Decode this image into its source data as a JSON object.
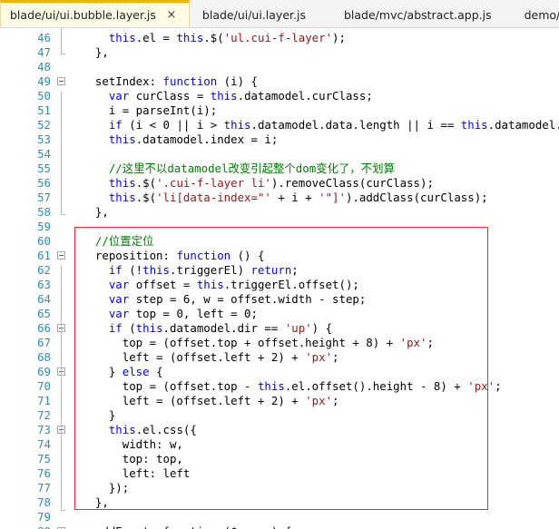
{
  "tabs": [
    {
      "label": "blade/ui/ui.bubble.layer.js",
      "active": true,
      "close": "×"
    },
    {
      "label": "blade/ui/ui.layer.js",
      "active": false
    },
    {
      "label": "blade/mvc/abstract.app.js",
      "active": false
    },
    {
      "label": "demo/main.js",
      "active": false
    }
  ],
  "colors": {
    "accent": "#f0b400",
    "keyword": "#0000ff",
    "string": "#a31515",
    "comment": "#008000",
    "line_number": "#2b91af",
    "highlight_border": "#d9312b"
  },
  "lines": [
    {
      "n": "46",
      "tokens": [
        [
          "",
          "    "
        ],
        [
          "kw",
          "this"
        ],
        [
          "",
          ".el = "
        ],
        [
          "kw",
          "this"
        ],
        [
          "",
          ".$("
        ],
        [
          "str",
          "'ul.cui-f-layer'"
        ],
        [
          "",
          ");"
        ]
      ]
    },
    {
      "n": "47",
      "tokens": [
        [
          "",
          "  },"
        ]
      ]
    },
    {
      "n": "48",
      "tokens": [
        [
          "",
          ""
        ]
      ]
    },
    {
      "n": "49",
      "fold": true,
      "tokens": [
        [
          "",
          "  setIndex: "
        ],
        [
          "kw",
          "function"
        ],
        [
          "",
          " (i) {"
        ]
      ]
    },
    {
      "n": "50",
      "tokens": [
        [
          "",
          "    "
        ],
        [
          "kw",
          "var"
        ],
        [
          "",
          " curClass = "
        ],
        [
          "kw",
          "this"
        ],
        [
          "",
          ".datamodel.curClass;"
        ]
      ]
    },
    {
      "n": "51",
      "tokens": [
        [
          "",
          "    i = parseInt(i);"
        ]
      ]
    },
    {
      "n": "52",
      "tokens": [
        [
          "",
          "    "
        ],
        [
          "kw",
          "if"
        ],
        [
          "",
          " (i < 0 || i > "
        ],
        [
          "kw",
          "this"
        ],
        [
          "",
          ".datamodel.data.length || i == "
        ],
        [
          "kw",
          "this"
        ],
        [
          "",
          ".datamodel.index"
        ]
      ]
    },
    {
      "n": "53",
      "tokens": [
        [
          "",
          "    "
        ],
        [
          "kw",
          "this"
        ],
        [
          "",
          ".datamodel.index = i;"
        ]
      ]
    },
    {
      "n": "54",
      "tokens": [
        [
          "",
          ""
        ]
      ]
    },
    {
      "n": "55",
      "tokens": [
        [
          "",
          "    "
        ],
        [
          "cm",
          "//这里不以datamodel改变引起整个dom变化了，不划算"
        ]
      ]
    },
    {
      "n": "56",
      "tokens": [
        [
          "",
          "    "
        ],
        [
          "kw",
          "this"
        ],
        [
          "",
          ".$("
        ],
        [
          "str",
          "'.cui-f-layer li'"
        ],
        [
          "",
          ").removeClass(curClass);"
        ]
      ]
    },
    {
      "n": "57",
      "tokens": [
        [
          "",
          "    "
        ],
        [
          "kw",
          "this"
        ],
        [
          "",
          ".$("
        ],
        [
          "str",
          "'li[data-index=\"'"
        ],
        [
          "",
          " + i + "
        ],
        [
          "str",
          "'\"]'"
        ],
        [
          "",
          ").addClass(curClass);"
        ]
      ]
    },
    {
      "n": "58",
      "tokens": [
        [
          "",
          "  },"
        ]
      ]
    },
    {
      "n": "59",
      "tokens": [
        [
          "",
          ""
        ]
      ]
    },
    {
      "n": "60",
      "tokens": [
        [
          "",
          "  "
        ],
        [
          "cm",
          "//位置定位"
        ]
      ]
    },
    {
      "n": "61",
      "fold": true,
      "tokens": [
        [
          "",
          "  reposition: "
        ],
        [
          "kw",
          "function"
        ],
        [
          "",
          " () {"
        ]
      ]
    },
    {
      "n": "62",
      "tokens": [
        [
          "",
          "    "
        ],
        [
          "kw",
          "if"
        ],
        [
          "",
          " (!"
        ],
        [
          "kw",
          "this"
        ],
        [
          "",
          ".triggerEl) "
        ],
        [
          "kw",
          "return"
        ],
        [
          "",
          ";"
        ]
      ]
    },
    {
      "n": "63",
      "tokens": [
        [
          "",
          "    "
        ],
        [
          "kw",
          "var"
        ],
        [
          "",
          " offset = "
        ],
        [
          "kw",
          "this"
        ],
        [
          "",
          ".triggerEl.offset();"
        ]
      ]
    },
    {
      "n": "64",
      "tokens": [
        [
          "",
          "    "
        ],
        [
          "kw",
          "var"
        ],
        [
          "",
          " step = 6, w = offset.width - step;"
        ]
      ]
    },
    {
      "n": "65",
      "tokens": [
        [
          "",
          "    "
        ],
        [
          "kw",
          "var"
        ],
        [
          "",
          " top = 0, left = 0;"
        ]
      ]
    },
    {
      "n": "66",
      "fold": true,
      "tokens": [
        [
          "",
          "    "
        ],
        [
          "kw",
          "if"
        ],
        [
          "",
          " ("
        ],
        [
          "kw",
          "this"
        ],
        [
          "",
          ".datamodel.dir == "
        ],
        [
          "str",
          "'up'"
        ],
        [
          "",
          ") {"
        ]
      ]
    },
    {
      "n": "67",
      "tokens": [
        [
          "",
          "      top = (offset.top + offset.height + 8) + "
        ],
        [
          "str",
          "'px'"
        ],
        [
          "",
          ";"
        ]
      ]
    },
    {
      "n": "68",
      "tokens": [
        [
          "",
          "      left = (offset.left + 2) + "
        ],
        [
          "str",
          "'px'"
        ],
        [
          "",
          ";"
        ]
      ]
    },
    {
      "n": "69",
      "fold": true,
      "tokens": [
        [
          "",
          "    } "
        ],
        [
          "kw",
          "else"
        ],
        [
          "",
          " {"
        ]
      ]
    },
    {
      "n": "70",
      "tokens": [
        [
          "",
          "      top = (offset.top - "
        ],
        [
          "kw",
          "this"
        ],
        [
          "",
          ".el.offset().height - 8) + "
        ],
        [
          "str",
          "'px'"
        ],
        [
          "",
          ";"
        ]
      ]
    },
    {
      "n": "71",
      "tokens": [
        [
          "",
          "      left = (offset.left + 2) + "
        ],
        [
          "str",
          "'px'"
        ],
        [
          "",
          ";"
        ]
      ]
    },
    {
      "n": "72",
      "tokens": [
        [
          "",
          "    }"
        ]
      ]
    },
    {
      "n": "73",
      "fold": true,
      "tokens": [
        [
          "",
          "    "
        ],
        [
          "kw",
          "this"
        ],
        [
          "",
          ".el.css({"
        ]
      ]
    },
    {
      "n": "74",
      "tokens": [
        [
          "",
          "      width: w,"
        ]
      ]
    },
    {
      "n": "75",
      "tokens": [
        [
          "",
          "      top: top,"
        ]
      ]
    },
    {
      "n": "76",
      "tokens": [
        [
          "",
          "      left: left"
        ]
      ]
    },
    {
      "n": "77",
      "tokens": [
        [
          "",
          "    });"
        ]
      ]
    },
    {
      "n": "78",
      "tokens": [
        [
          "",
          "  },"
        ]
      ]
    },
    {
      "n": "79",
      "tokens": [
        [
          "",
          ""
        ]
      ]
    },
    {
      "n": "80",
      "fold": true,
      "tokens": [
        [
          "",
          "  addEvent: "
        ],
        [
          "kw",
          "function"
        ],
        [
          "",
          " ($super) {"
        ]
      ]
    }
  ]
}
